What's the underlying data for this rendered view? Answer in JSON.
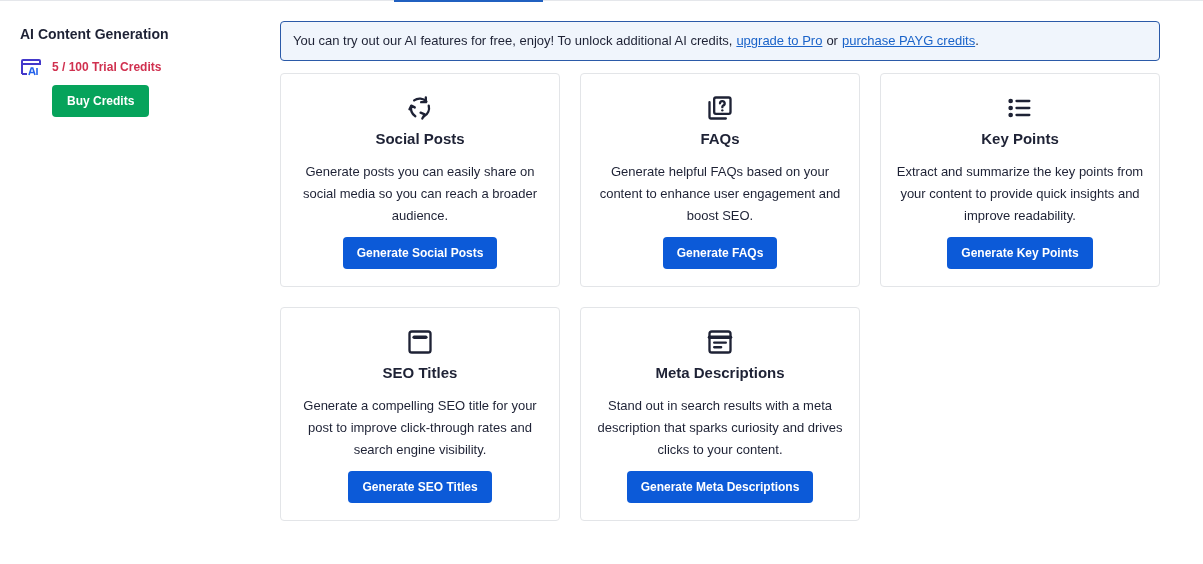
{
  "sidebar": {
    "title": "AI Content Generation",
    "credits": "5 / 100 Trial Credits",
    "buy_button": "Buy Credits"
  },
  "notice": {
    "text_before": "You can try out our AI features for free, enjoy! To unlock additional AI credits,",
    "link_1": "upgrade to Pro",
    "text_between": "or",
    "link_2": "purchase PAYG credits",
    "text_after": "."
  },
  "cards": [
    {
      "kind": "social",
      "title": "Social Posts",
      "description": "Generate posts you can easily share on social media so you can reach a broader audience.",
      "button": "Generate Social Posts"
    },
    {
      "kind": "faq",
      "title": "FAQs",
      "description": "Generate helpful FAQs based on your content to enhance user engagement and boost SEO.",
      "button": "Generate FAQs"
    },
    {
      "kind": "list",
      "title": "Key Points",
      "description": "Extract and summarize the key points from your content to provide quick insights and improve readability.",
      "button": "Generate Key Points"
    },
    {
      "kind": "title",
      "title": "SEO Titles",
      "description": "Generate a compelling SEO title for your post to improve click-through rates and search engine visibility.",
      "button": "Generate SEO Titles"
    },
    {
      "kind": "meta",
      "title": "Meta Descriptions",
      "description": "Stand out in search results with a meta description that sparks curiosity and drives clicks to your content.",
      "button": "Generate Meta Descriptions"
    }
  ]
}
